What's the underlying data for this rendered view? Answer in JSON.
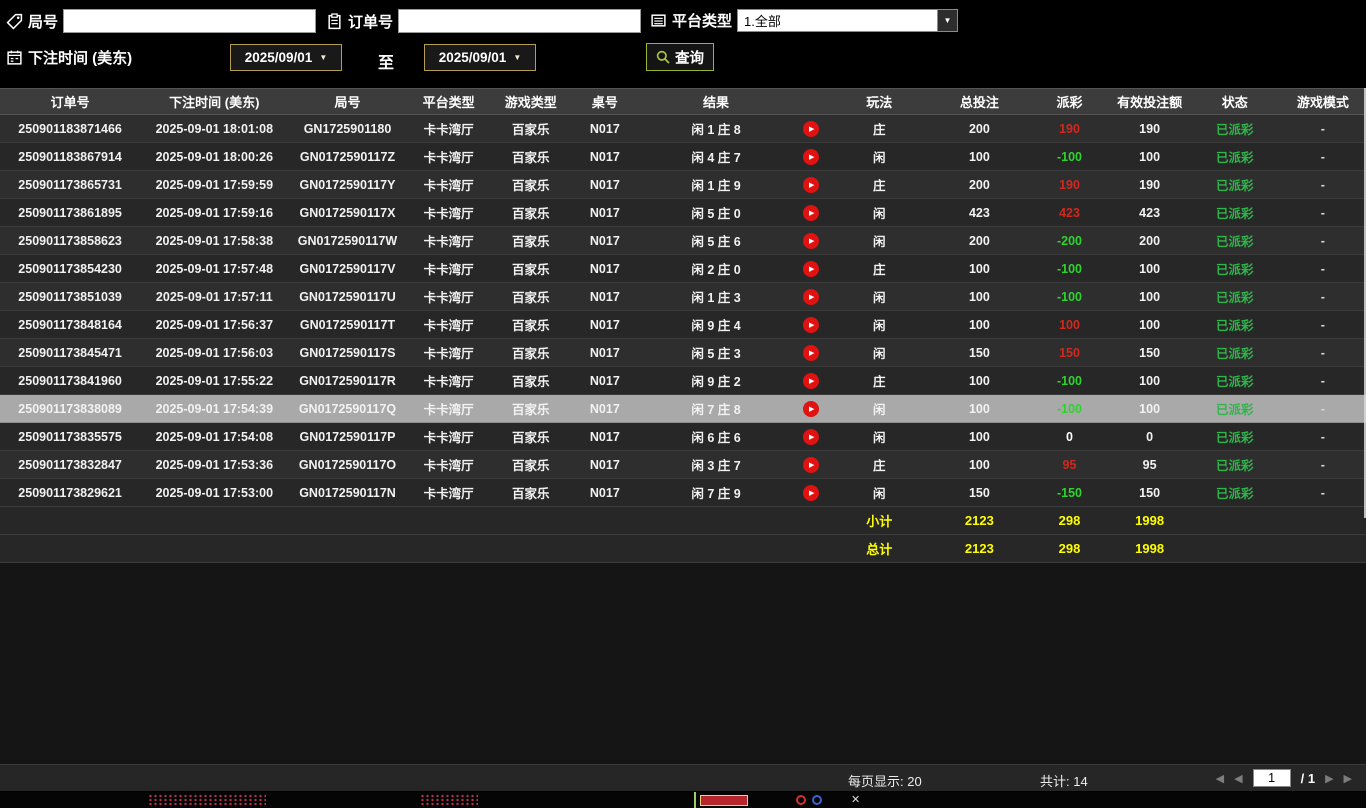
{
  "filters": {
    "round": {
      "label": "局号",
      "value": ""
    },
    "order": {
      "label": "订单号",
      "value": ""
    },
    "platform": {
      "label": "平台类型",
      "value": "1.全部"
    },
    "bet_time": {
      "label": "下注时间 (美东)",
      "from": "2025/09/01",
      "to_label": "至",
      "to": "2025/09/01"
    },
    "search_label": "查询"
  },
  "icons": {
    "play": "▶",
    "dropdown_arrow": "▼",
    "first_page": "◀",
    "prev_page": "◀",
    "next_page": "▶",
    "last_page": "▶",
    "close": "✕"
  },
  "colors": {
    "win": "#d2281e",
    "loss": "#2ed32e",
    "paid": "#31b44a",
    "summary": "#ffff00",
    "selected_row": "#a9a9a9"
  },
  "table": {
    "headers": [
      "订单号",
      "下注时间 (美东)",
      "局号",
      "平台类型",
      "游戏类型",
      "桌号",
      "结果",
      "玩法",
      "总投注",
      "派彩",
      "有效投注额",
      "状态",
      "游戏模式"
    ],
    "rows": [
      {
        "order_no": "250901183871466",
        "bet_time": "2025-09-01 18:01:08",
        "round_no": "GN1725901180",
        "platform": "卡卡湾厅",
        "game_type": "百家乐",
        "table_no": "N017",
        "result": "闲 1 庄 8",
        "play": "庄",
        "total_bet": "200",
        "payout": "190",
        "payout_class": "pos",
        "valid_bet": "190",
        "status": "已派彩",
        "game_mode": "-",
        "selected": false
      },
      {
        "order_no": "250901183867914",
        "bet_time": "2025-09-01 18:00:26",
        "round_no": "GN0172590117Z",
        "platform": "卡卡湾厅",
        "game_type": "百家乐",
        "table_no": "N017",
        "result": "闲 4 庄 7",
        "play": "闲",
        "total_bet": "100",
        "payout": "-100",
        "payout_class": "neg",
        "valid_bet": "100",
        "status": "已派彩",
        "game_mode": "-",
        "selected": false
      },
      {
        "order_no": "250901173865731",
        "bet_time": "2025-09-01 17:59:59",
        "round_no": "GN0172590117Y",
        "platform": "卡卡湾厅",
        "game_type": "百家乐",
        "table_no": "N017",
        "result": "闲 1 庄 9",
        "play": "庄",
        "total_bet": "200",
        "payout": "190",
        "payout_class": "pos",
        "valid_bet": "190",
        "status": "已派彩",
        "game_mode": "-",
        "selected": false
      },
      {
        "order_no": "250901173861895",
        "bet_time": "2025-09-01 17:59:16",
        "round_no": "GN0172590117X",
        "platform": "卡卡湾厅",
        "game_type": "百家乐",
        "table_no": "N017",
        "result": "闲 5 庄 0",
        "play": "闲",
        "total_bet": "423",
        "payout": "423",
        "payout_class": "pos",
        "valid_bet": "423",
        "status": "已派彩",
        "game_mode": "-",
        "selected": false
      },
      {
        "order_no": "250901173858623",
        "bet_time": "2025-09-01 17:58:38",
        "round_no": "GN0172590117W",
        "platform": "卡卡湾厅",
        "game_type": "百家乐",
        "table_no": "N017",
        "result": "闲 5 庄 6",
        "play": "闲",
        "total_bet": "200",
        "payout": "-200",
        "payout_class": "neg",
        "valid_bet": "200",
        "status": "已派彩",
        "game_mode": "-",
        "selected": false
      },
      {
        "order_no": "250901173854230",
        "bet_time": "2025-09-01 17:57:48",
        "round_no": "GN0172590117V",
        "platform": "卡卡湾厅",
        "game_type": "百家乐",
        "table_no": "N017",
        "result": "闲 2 庄 0",
        "play": "庄",
        "total_bet": "100",
        "payout": "-100",
        "payout_class": "neg",
        "valid_bet": "100",
        "status": "已派彩",
        "game_mode": "-",
        "selected": false
      },
      {
        "order_no": "250901173851039",
        "bet_time": "2025-09-01 17:57:11",
        "round_no": "GN0172590117U",
        "platform": "卡卡湾厅",
        "game_type": "百家乐",
        "table_no": "N017",
        "result": "闲 1 庄 3",
        "play": "闲",
        "total_bet": "100",
        "payout": "-100",
        "payout_class": "neg",
        "valid_bet": "100",
        "status": "已派彩",
        "game_mode": "-",
        "selected": false
      },
      {
        "order_no": "250901173848164",
        "bet_time": "2025-09-01 17:56:37",
        "round_no": "GN0172590117T",
        "platform": "卡卡湾厅",
        "game_type": "百家乐",
        "table_no": "N017",
        "result": "闲 9 庄 4",
        "play": "闲",
        "total_bet": "100",
        "payout": "100",
        "payout_class": "pos",
        "valid_bet": "100",
        "status": "已派彩",
        "game_mode": "-",
        "selected": false
      },
      {
        "order_no": "250901173845471",
        "bet_time": "2025-09-01 17:56:03",
        "round_no": "GN0172590117S",
        "platform": "卡卡湾厅",
        "game_type": "百家乐",
        "table_no": "N017",
        "result": "闲 5 庄 3",
        "play": "闲",
        "total_bet": "150",
        "payout": "150",
        "payout_class": "pos",
        "valid_bet": "150",
        "status": "已派彩",
        "game_mode": "-",
        "selected": false
      },
      {
        "order_no": "250901173841960",
        "bet_time": "2025-09-01 17:55:22",
        "round_no": "GN0172590117R",
        "platform": "卡卡湾厅",
        "game_type": "百家乐",
        "table_no": "N017",
        "result": "闲 9 庄 2",
        "play": "庄",
        "total_bet": "100",
        "payout": "-100",
        "payout_class": "neg",
        "valid_bet": "100",
        "status": "已派彩",
        "game_mode": "-",
        "selected": false
      },
      {
        "order_no": "250901173838089",
        "bet_time": "2025-09-01 17:54:39",
        "round_no": "GN0172590117Q",
        "platform": "卡卡湾厅",
        "game_type": "百家乐",
        "table_no": "N017",
        "result": "闲 7 庄 8",
        "play": "闲",
        "total_bet": "100",
        "payout": "-100",
        "payout_class": "neg",
        "valid_bet": "100",
        "status": "已派彩",
        "game_mode": "-",
        "selected": true
      },
      {
        "order_no": "250901173835575",
        "bet_time": "2025-09-01 17:54:08",
        "round_no": "GN0172590117P",
        "platform": "卡卡湾厅",
        "game_type": "百家乐",
        "table_no": "N017",
        "result": "闲 6 庄 6",
        "play": "闲",
        "total_bet": "100",
        "payout": "0",
        "payout_class": "zero",
        "valid_bet": "0",
        "status": "已派彩",
        "game_mode": "-",
        "selected": false
      },
      {
        "order_no": "250901173832847",
        "bet_time": "2025-09-01 17:53:36",
        "round_no": "GN0172590117O",
        "platform": "卡卡湾厅",
        "game_type": "百家乐",
        "table_no": "N017",
        "result": "闲 3 庄 7",
        "play": "庄",
        "total_bet": "100",
        "payout": "95",
        "payout_class": "pos",
        "valid_bet": "95",
        "status": "已派彩",
        "game_mode": "-",
        "selected": false
      },
      {
        "order_no": "250901173829621",
        "bet_time": "2025-09-01 17:53:00",
        "round_no": "GN0172590117N",
        "platform": "卡卡湾厅",
        "game_type": "百家乐",
        "table_no": "N017",
        "result": "闲 7 庄 9",
        "play": "闲",
        "total_bet": "150",
        "payout": "-150",
        "payout_class": "neg",
        "valid_bet": "150",
        "status": "已派彩",
        "game_mode": "-",
        "selected": false
      }
    ],
    "subtotal": {
      "label": "小计",
      "total_bet": "2123",
      "payout": "298",
      "valid_bet": "1998"
    },
    "total": {
      "label": "总计",
      "total_bet": "2123",
      "payout": "298",
      "valid_bet": "1998"
    }
  },
  "footer": {
    "per_page": "每页显示: 20",
    "total_count": "共计: 14",
    "page_value": "1",
    "page_suffix": "/  1"
  }
}
